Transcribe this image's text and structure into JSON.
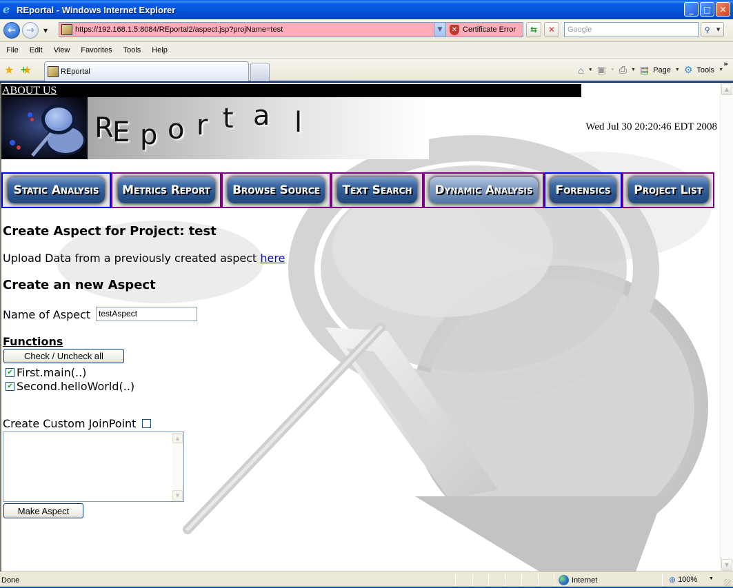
{
  "window": {
    "title": "REportal - Windows Internet Explorer",
    "controls": {
      "minimize": "_",
      "maximize": "□",
      "close": "✕"
    }
  },
  "addressbar": {
    "url": "https://192.168.1.5:8084/REportal2/aspect.jsp?projName=test",
    "certificate_status": "Certificate Error",
    "search_placeholder": "Google",
    "icons": {
      "back": "back-arrow-icon",
      "forward": "forward-arrow-icon",
      "refresh": "refresh-icon",
      "stop": "stop-icon",
      "search": "search-icon",
      "certificate": "shield-error-icon"
    },
    "url_bar_color": "#ffadb6"
  },
  "menubar": {
    "items": [
      "File",
      "Edit",
      "View",
      "Favorites",
      "Tools",
      "Help"
    ]
  },
  "commandbar": {
    "tab_label": "REportal",
    "page_label": "Page",
    "tools_label": "Tools",
    "more": "»"
  },
  "page": {
    "about_us": "ABOUT US",
    "brand_letters": [
      "R",
      "E",
      "p",
      "o",
      "r",
      "t",
      "a",
      "l"
    ],
    "datestamp": "Wed Jul 30 20:20:46 EDT 2008",
    "nav": [
      {
        "label": "Static Analysis",
        "border": "#0000ff",
        "style": "normal"
      },
      {
        "label": "Metrics Report",
        "border": "#800080",
        "style": "normal"
      },
      {
        "label": "Browse Source",
        "border": "#800080",
        "style": "normal"
      },
      {
        "label": "Text Search",
        "border": "#800080",
        "style": "normal"
      },
      {
        "label": "Dynamic Analysis",
        "border": "#800080",
        "style": "highlighted"
      },
      {
        "label": "Forensics",
        "border": "#0000ff",
        "style": "normal"
      },
      {
        "label": "Project List",
        "border": "#800080",
        "style": "normal"
      }
    ],
    "heading": "Create Aspect for Project: test",
    "upload_text": "Upload Data from a previously created aspect ",
    "upload_link": "here",
    "subheading": "Create an new Aspect",
    "name_label": "Name of Aspect",
    "name_value": "testAspect",
    "functions_heading": "Functions",
    "check_all_label": "Check / Uncheck all",
    "functions": [
      {
        "label": "First.main(..)",
        "checked": true
      },
      {
        "label": "Second.helloWorld(..)",
        "checked": true
      }
    ],
    "custom_joinpoint_label": "Create Custom JoinPoint",
    "custom_joinpoint_checked": false,
    "custom_joinpoint_text": "",
    "make_aspect_label": "Make Aspect"
  },
  "statusbar": {
    "status": "Done",
    "zone": "Internet",
    "zoom": "100%"
  }
}
